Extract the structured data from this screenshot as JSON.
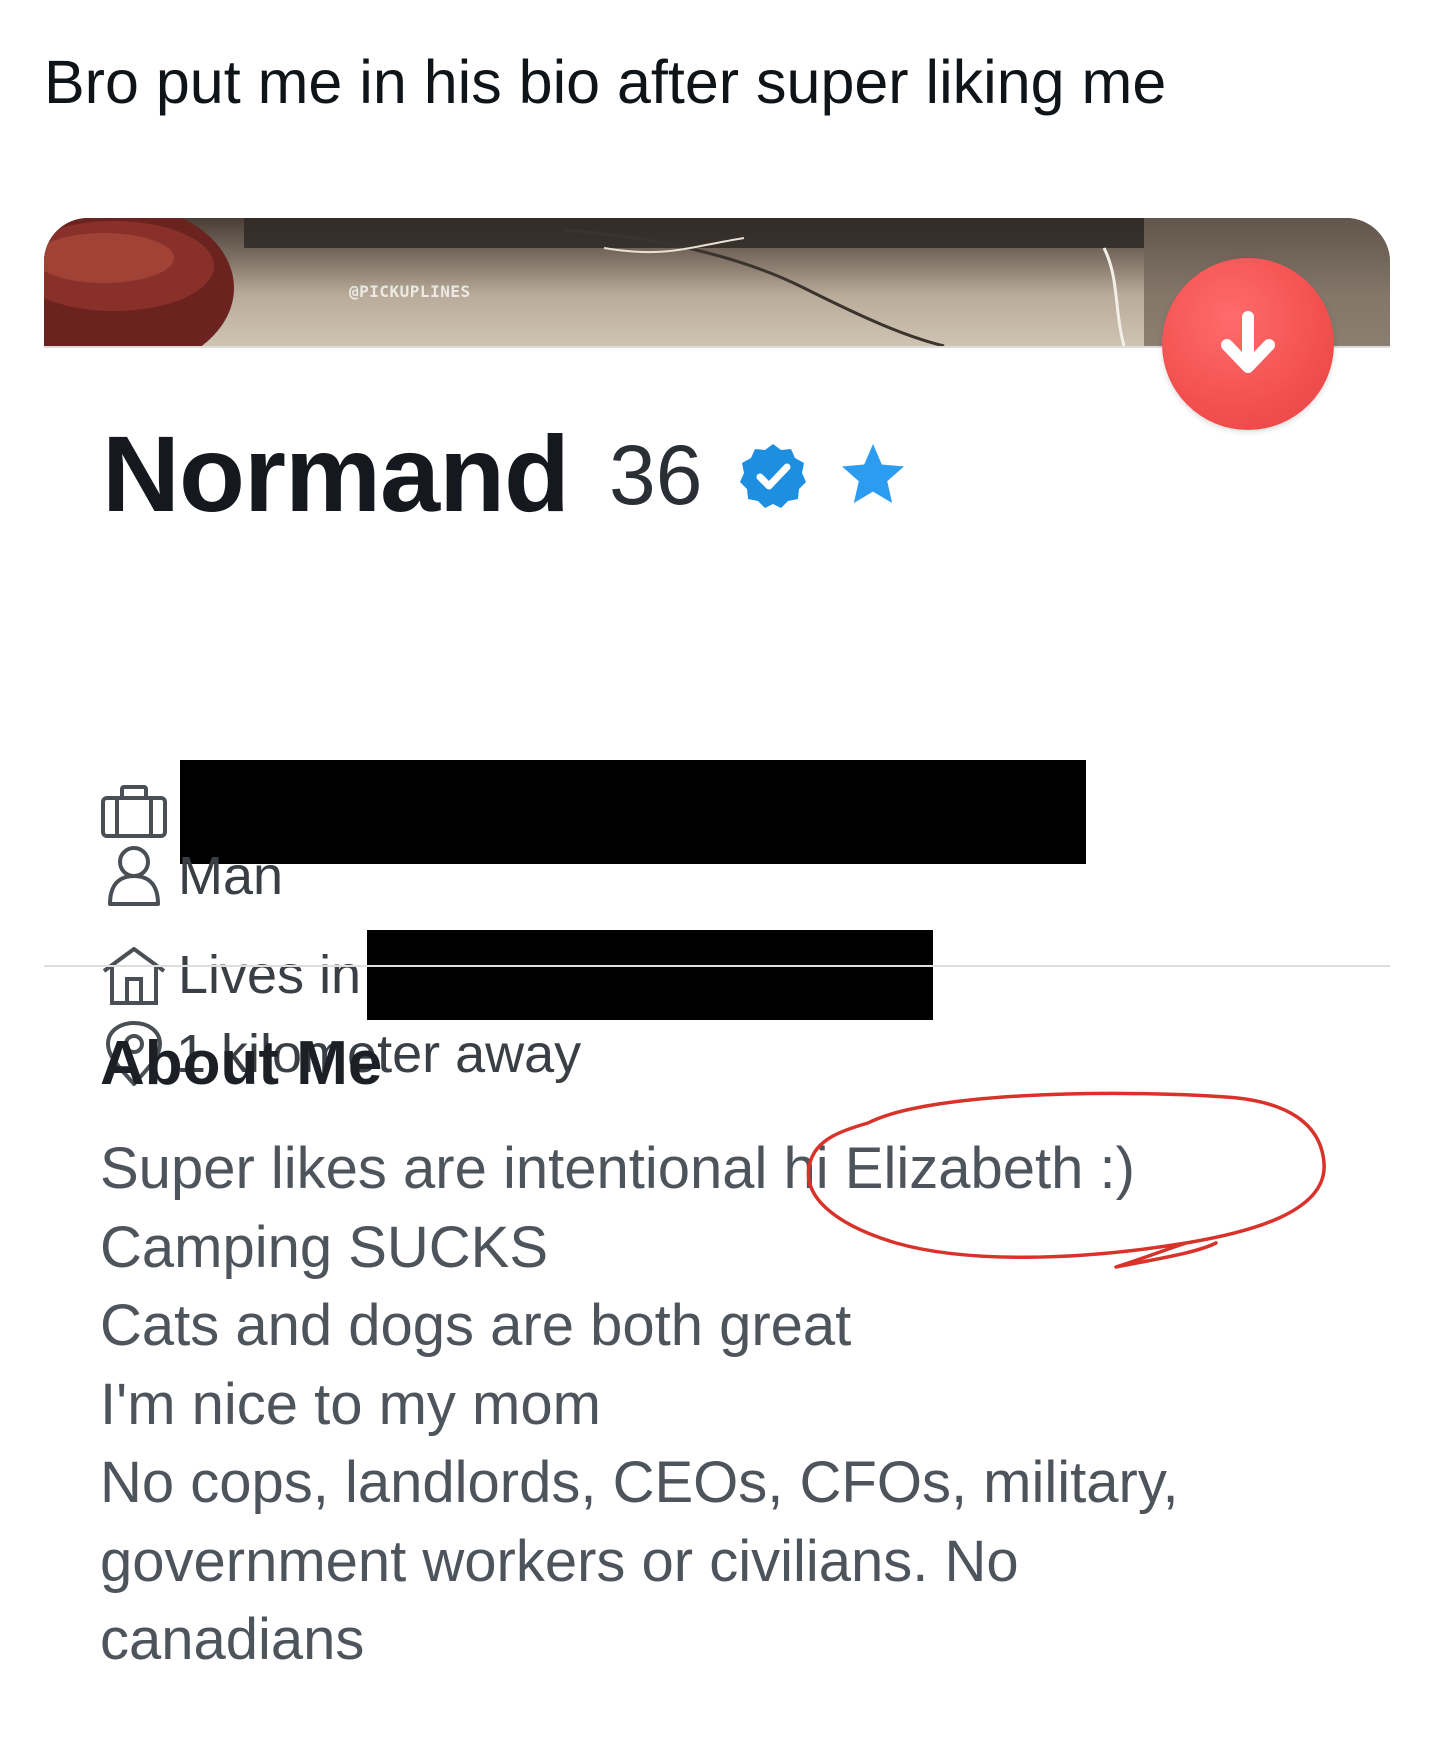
{
  "caption": "Bro put me in his bio after super liking me",
  "photo": {
    "watermark": "@PICKUPLINES"
  },
  "profile": {
    "name": "Normand",
    "age": "36",
    "gender": "Man",
    "lives_in_label": "Lives in",
    "distance": "1 kilometer away"
  },
  "about": {
    "title": "About Me",
    "lines": [
      "Super likes are intentional hi Elizabeth :)",
      "Camping SUCKS",
      "Cats and dogs are both great",
      "I'm nice to my mom",
      "No cops, landlords, CEOs, CFOs, military,",
      "government workers or civilians. No",
      "canadians"
    ]
  },
  "icons": {
    "rewind": "arrow-down-icon",
    "verified": "verified-badge-icon",
    "super_like": "star-icon",
    "job": "briefcase-icon",
    "gender": "person-icon",
    "home": "house-icon",
    "location": "location-pin-icon"
  },
  "colors": {
    "rewind_button": "#f2504f",
    "verified_blue": "#1d8fe1",
    "annotation_red": "#d8322b"
  }
}
